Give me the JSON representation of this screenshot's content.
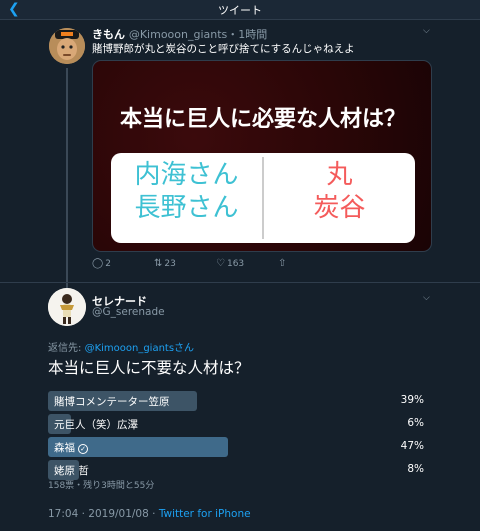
{
  "header": {
    "back_icon": "chevron-left-icon",
    "title": "ツイート"
  },
  "tweet1": {
    "display_name": "きもん",
    "handle": "@Kimooon_giants",
    "time": "・1時間",
    "text": "賭博野郎が丸と炭谷のこと呼び捨てにするんじゃねえよ",
    "image": {
      "title": "本当に巨人に必要な人材は？",
      "left_line1": "内海さん",
      "left_line2": "長野さん",
      "right_line1": "丸",
      "right_line2": "炭谷"
    },
    "actions": {
      "reply_count": "2",
      "retweet_count": "23",
      "like_count": "163"
    }
  },
  "tweet2": {
    "display_name": "セレナード",
    "handle": "@G_serenade",
    "reply_prefix": "返信先: ",
    "reply_mention": "@Kimooon_giantsさん",
    "question": "本当に巨人に不要な人材は？",
    "poll": {
      "options": [
        {
          "label": "賭博コメンテーター笠原",
          "percent": "39%",
          "value": 39
        },
        {
          "label": "元巨人（笑）広澤",
          "percent": "6%",
          "value": 6
        },
        {
          "label": "森福",
          "percent": "47%",
          "value": 47,
          "selected": true
        },
        {
          "label": "姥原 哲",
          "percent": "8%",
          "value": 8
        }
      ],
      "meta": "158票・残り3時間と55分"
    },
    "timestamp": "17:04 · 2019/01/08 · ",
    "source": "Twitter for iPhone"
  },
  "colors": {
    "background": "#15202b",
    "accent": "#1da1f2",
    "muted": "#8899a6",
    "poll_bar": "#3d5466"
  }
}
